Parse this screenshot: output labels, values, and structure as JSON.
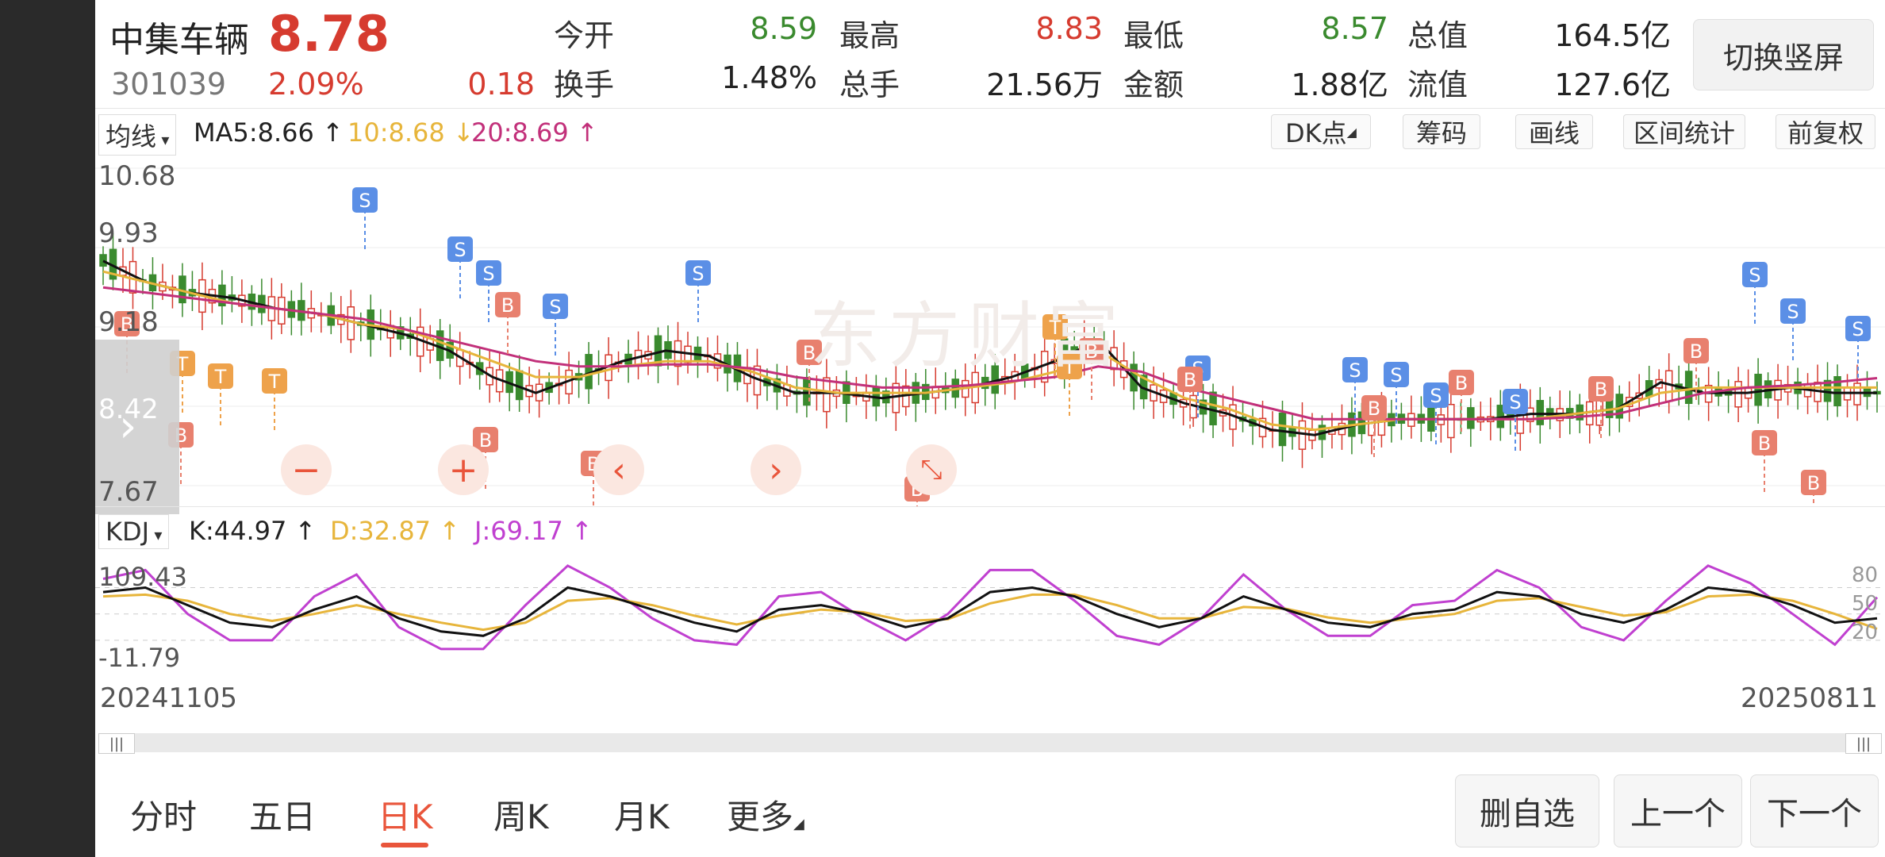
{
  "stock": {
    "name": "中集车辆",
    "price": "8.78",
    "code": "301039",
    "change_pct": "2.09%",
    "change": "0.18"
  },
  "stats": [
    {
      "label": "今开",
      "value": "8.59",
      "color": "green"
    },
    {
      "label": "最高",
      "value": "8.83",
      "color": "red"
    },
    {
      "label": "最低",
      "value": "8.57",
      "color": "green"
    },
    {
      "label": "总值",
      "value": "164.5亿",
      "color": "dark"
    },
    {
      "label": "换手",
      "value": "1.48%",
      "color": "dark"
    },
    {
      "label": "总手",
      "value": "21.56万",
      "color": "dark"
    },
    {
      "label": "金额",
      "value": "1.88亿",
      "color": "dark"
    },
    {
      "label": "流值",
      "value": "127.6亿",
      "color": "dark"
    }
  ],
  "switch_label": "切换竖屏",
  "ma_selector": "均线",
  "ma_values": {
    "ma5": "MA5:8.66",
    "ma10": "10:8.68",
    "ma20": "20:8.69"
  },
  "tools": [
    "DK点",
    "筹码",
    "画线",
    "区间统计",
    "前复权"
  ],
  "price_axis": [
    "10.68",
    "9.93",
    "9.18",
    "8.42",
    "7.67"
  ],
  "kdj_selector": "KDJ",
  "kdj_values": {
    "k": "K:44.97",
    "d": "D:32.87",
    "j": "J:69.17"
  },
  "kdj_axis": {
    "top": "109.43",
    "bottom": "-11.79",
    "right": [
      "80",
      "50",
      "20"
    ]
  },
  "dates": {
    "start": "20241105",
    "end": "20250811"
  },
  "tabs": [
    "分时",
    "五日",
    "日K",
    "周K",
    "月K",
    "更多"
  ],
  "active_tab": "日K",
  "bottom_buttons": [
    "删自选",
    "上一个",
    "下一个"
  ],
  "watermark": "东方财富",
  "colors": {
    "up": "#d63b2f",
    "down": "#3a8a2e",
    "ma5": "#111111",
    "ma10": "#e7b53b",
    "ma20": "#c2307a",
    "k": "#111111",
    "d": "#e7b53b",
    "j": "#c040d0",
    "accent": "#e9553b"
  },
  "chart_data": {
    "type": "line",
    "note_axis": "daily candlesticks 20241105 to 20250811",
    "ylim": [
      7.67,
      10.68
    ],
    "series": [
      {
        "name": "MA5",
        "values": [
          9.8,
          9.6,
          9.5,
          9.45,
          9.35,
          9.3,
          9.2,
          9.1,
          8.95,
          8.7,
          8.55,
          8.7,
          8.85,
          8.95,
          8.9,
          8.7,
          8.55,
          8.55,
          8.5,
          8.55,
          8.6,
          8.7,
          8.85,
          9.05,
          8.6,
          8.45,
          8.35,
          8.2,
          8.15,
          8.25,
          8.3,
          8.3,
          8.3,
          8.35,
          8.35,
          8.4,
          8.65,
          8.55,
          8.55,
          8.6,
          8.55,
          8.55
        ]
      },
      {
        "name": "10",
        "values": [
          9.7,
          9.6,
          9.5,
          9.4,
          9.35,
          9.3,
          9.2,
          9.15,
          9.0,
          8.85,
          8.7,
          8.7,
          8.8,
          8.85,
          8.85,
          8.75,
          8.6,
          8.55,
          8.55,
          8.55,
          8.6,
          8.65,
          8.75,
          8.95,
          8.7,
          8.5,
          8.4,
          8.25,
          8.2,
          8.25,
          8.3,
          8.3,
          8.3,
          8.3,
          8.35,
          8.4,
          8.55,
          8.6,
          8.6,
          8.6,
          8.6,
          8.6
        ]
      },
      {
        "name": "20",
        "values": [
          9.55,
          9.5,
          9.45,
          9.4,
          9.35,
          9.3,
          9.25,
          9.15,
          9.05,
          8.95,
          8.85,
          8.8,
          8.8,
          8.82,
          8.82,
          8.78,
          8.7,
          8.65,
          8.6,
          8.6,
          8.62,
          8.66,
          8.7,
          8.8,
          8.75,
          8.6,
          8.5,
          8.4,
          8.3,
          8.3,
          8.3,
          8.3,
          8.3,
          8.3,
          8.32,
          8.35,
          8.45,
          8.55,
          8.6,
          8.62,
          8.65,
          8.69
        ]
      }
    ],
    "kdj": {
      "ylim": [
        -11.79,
        109.43
      ],
      "k": [
        75,
        80,
        60,
        40,
        35,
        55,
        70,
        45,
        30,
        25,
        45,
        80,
        70,
        55,
        40,
        30,
        55,
        60,
        50,
        35,
        45,
        75,
        80,
        70,
        50,
        35,
        45,
        70,
        55,
        40,
        35,
        50,
        55,
        75,
        70,
        50,
        40,
        55,
        80,
        75,
        60,
        40,
        45
      ],
      "d": [
        70,
        72,
        65,
        50,
        42,
        50,
        60,
        50,
        40,
        32,
        40,
        65,
        68,
        60,
        48,
        38,
        48,
        55,
        52,
        42,
        44,
        62,
        72,
        72,
        60,
        45,
        45,
        58,
        56,
        46,
        40,
        45,
        50,
        65,
        68,
        58,
        48,
        52,
        70,
        72,
        65,
        50,
        33
      ],
      "j": [
        90,
        100,
        50,
        20,
        20,
        70,
        95,
        35,
        10,
        10,
        60,
        105,
        80,
        45,
        20,
        15,
        70,
        75,
        45,
        20,
        50,
        100,
        100,
        65,
        25,
        15,
        45,
        95,
        55,
        25,
        25,
        60,
        65,
        100,
        80,
        35,
        20,
        65,
        105,
        85,
        50,
        15,
        69
      ]
    }
  }
}
